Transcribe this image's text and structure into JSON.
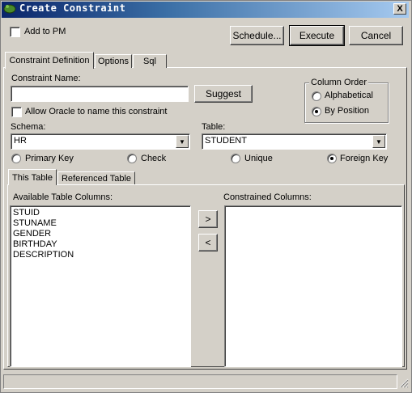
{
  "window": {
    "title": "Create Constraint",
    "close_label": "X"
  },
  "top": {
    "add_to_pm_label": "Add to PM",
    "schedule_label": "Schedule...",
    "execute_label": "Execute",
    "cancel_label": "Cancel"
  },
  "tabs": [
    "Constraint Definition",
    "Options",
    "Sql"
  ],
  "form": {
    "constraint_name_label": "Constraint Name:",
    "constraint_name_value": "",
    "suggest_label": "Suggest",
    "allow_oracle_label": "Allow Oracle to name this constraint",
    "column_order": {
      "title": "Column Order",
      "alphabetical_label": "Alphabetical",
      "by_position_label": "By Position"
    },
    "schema_label": "Schema:",
    "schema_value": "HR",
    "table_label": "Table:",
    "table_value": "STUDENT",
    "type_primary_key": "Primary Key",
    "type_check": "Check",
    "type_unique": "Unique",
    "type_foreign_key": "Foreign Key"
  },
  "subtabs": [
    "This Table",
    "Referenced Table"
  ],
  "columns": {
    "available_label": "Available Table Columns:",
    "constrained_label": "Constrained Columns:",
    "available": [
      "STUID",
      "STUNAME",
      "GENDER",
      "BIRTHDAY",
      "DESCRIPTION"
    ],
    "constrained": [],
    "add_label": ">",
    "remove_label": "<"
  }
}
